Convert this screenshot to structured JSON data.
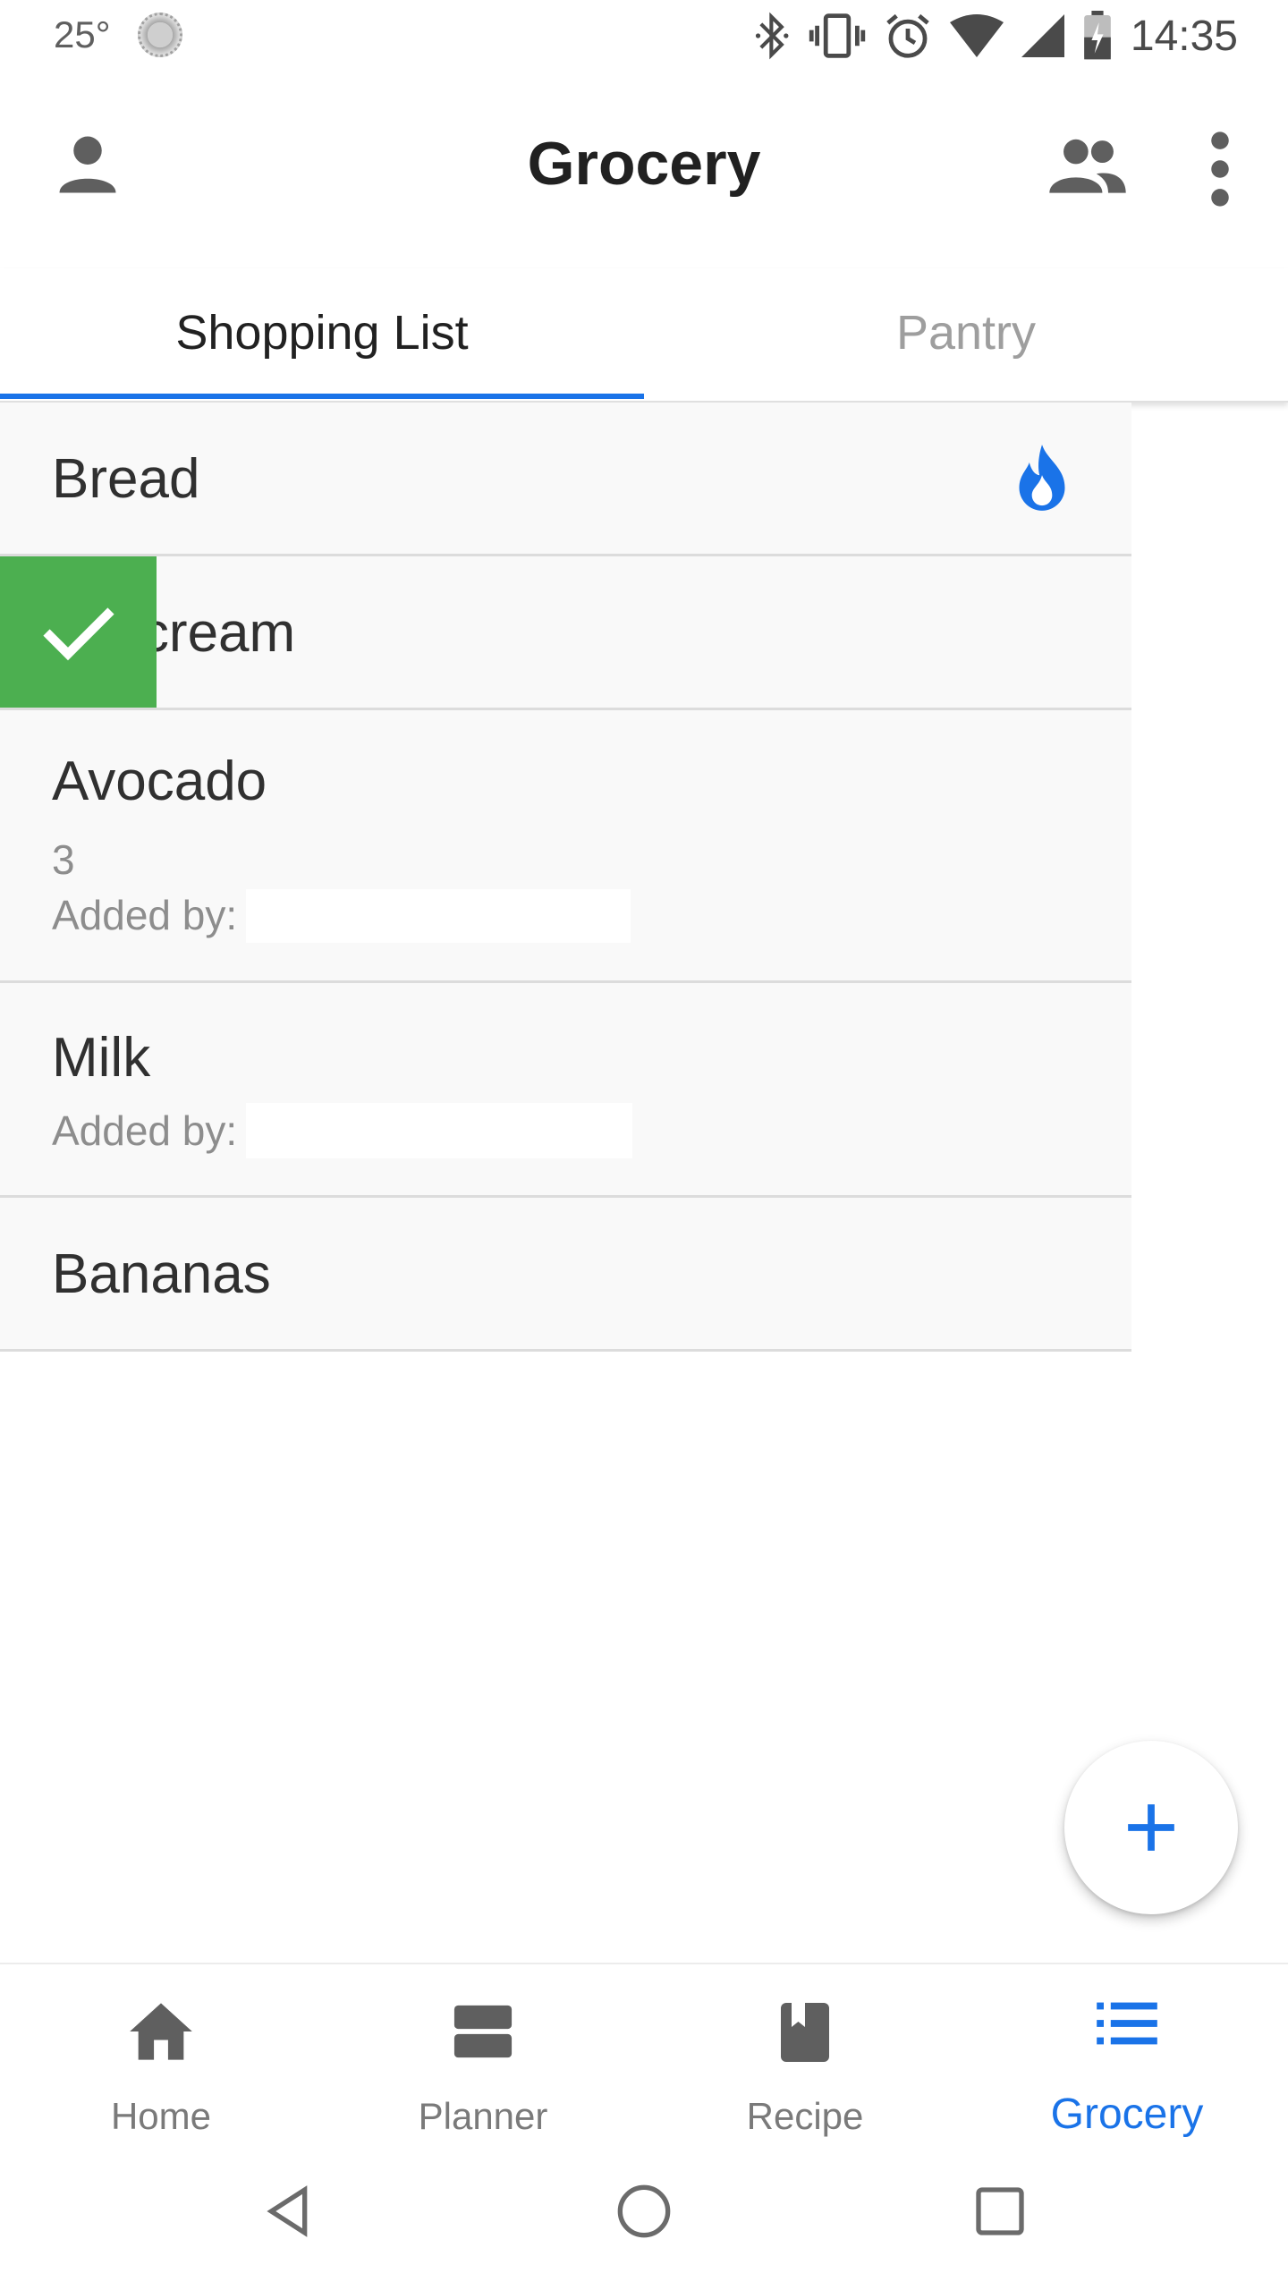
{
  "status_bar": {
    "temperature": "25°",
    "time": "14:35"
  },
  "app_bar": {
    "title": "Grocery"
  },
  "tabs": [
    {
      "label": "Shopping List",
      "active": true
    },
    {
      "label": "Pantry",
      "active": false
    }
  ],
  "list": {
    "items": [
      {
        "name": "Bread",
        "hot": true
      },
      {
        "name": "Ice cream",
        "visible_name": "cream",
        "swiped": true
      },
      {
        "name": "Avocado",
        "quantity": "3",
        "added_by_label": "Added by:"
      },
      {
        "name": "Milk",
        "added_by_label": "Added by:"
      },
      {
        "name": "Bananas"
      }
    ]
  },
  "fab": {
    "icon": "plus-icon"
  },
  "bottom_nav": {
    "items": [
      {
        "label": "Home",
        "icon": "home-icon"
      },
      {
        "label": "Planner",
        "icon": "planner-icon"
      },
      {
        "label": "Recipe",
        "icon": "book-icon"
      },
      {
        "label": "Grocery",
        "icon": "list-icon",
        "active": true
      }
    ]
  },
  "colors": {
    "accent": "#1a73e8",
    "swipe_green": "#4caf50",
    "row_bg": "#f9f9f9"
  }
}
